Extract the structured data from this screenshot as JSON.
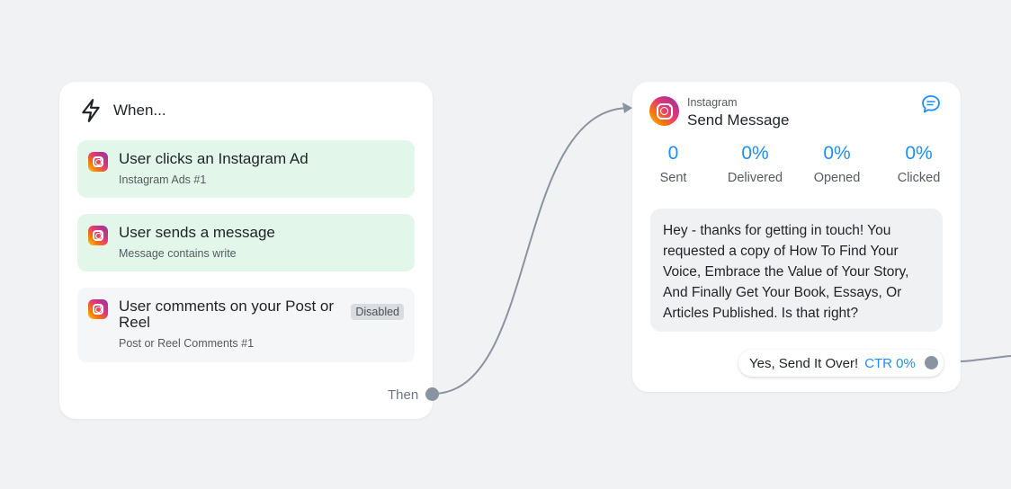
{
  "trigger": {
    "title": "When...",
    "items": [
      {
        "title": "User clicks an Instagram Ad",
        "subtitle": "Instagram Ads #1"
      },
      {
        "title": "User sends a message",
        "subtitle": "Message contains write"
      },
      {
        "title": "User comments on your Post or Reel",
        "subtitle": "Post or Reel Comments #1",
        "badge": "Disabled"
      }
    ],
    "then_label": "Then"
  },
  "message": {
    "channel": "Instagram",
    "title": "Send Message",
    "stats": [
      {
        "value": "0",
        "label": "Sent"
      },
      {
        "value": "0%",
        "label": "Delivered"
      },
      {
        "value": "0%",
        "label": "Opened"
      },
      {
        "value": "0%",
        "label": "Clicked"
      }
    ],
    "body": "Hey - thanks for getting in touch! You requested a copy of How To Find Your Voice, Embrace the Value of Your Story, And Finally Get Your Book, Essays, Or Articles Published. Is that right?",
    "reply_button": {
      "label": "Yes, Send It Over!",
      "ctr": "CTR 0%"
    }
  },
  "colors": {
    "accent": "#1f8ef1",
    "active_trigger_bg": "#e2f7ea",
    "connector": "#8a93a0"
  },
  "icons": {
    "trigger": "lightning-bolt-icon",
    "channel": "instagram-icon",
    "message_action": "chat-bubble-icon"
  }
}
